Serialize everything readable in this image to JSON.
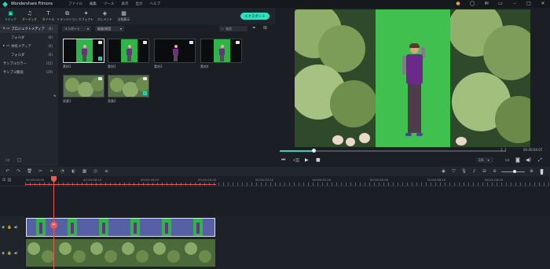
{
  "app": {
    "title": "Wondershare Filmora"
  },
  "menu": [
    "ファイル",
    "編集",
    "ツール",
    "表示",
    "出力",
    "ヘルプ"
  ],
  "toolbar": {
    "tabs": [
      {
        "label": "メディア",
        "icon": "media-icon"
      },
      {
        "label": "オーディオ",
        "icon": "music-icon"
      },
      {
        "label": "タイトル",
        "icon": "title-icon"
      },
      {
        "label": "トランジション",
        "icon": "transition-icon"
      },
      {
        "label": "エフェクト",
        "icon": "effect-icon"
      },
      {
        "label": "エレメント",
        "icon": "element-icon"
      },
      {
        "label": "分割表示",
        "icon": "split-icon"
      }
    ],
    "export_label": "エクスポート",
    "active_color": "#2ee6c3"
  },
  "left_panel": {
    "items": [
      {
        "label": "プロジェクトメディア",
        "count": "(6)"
      },
      {
        "label": "フォルダ",
        "count": "(6)"
      },
      {
        "label": "共有メディア",
        "count": "(0)"
      },
      {
        "label": "フォルダ",
        "count": "(0)"
      },
      {
        "label": "サンプルカラー",
        "count": "(15)"
      },
      {
        "label": "サンプル動画",
        "count": "(20)"
      }
    ]
  },
  "media": {
    "import_label": "インポート",
    "record_label": "録画/録音",
    "search_placeholder": "検索",
    "clips": [
      {
        "label": "素材1"
      },
      {
        "label": "素材1"
      },
      {
        "label": "素材3"
      },
      {
        "label": "素材4"
      },
      {
        "label": "背景1"
      },
      {
        "label": "背景2"
      }
    ]
  },
  "preview": {
    "timecode": "00:00:04:07",
    "quality": "2/6",
    "progress": 0.15
  },
  "timeline": {
    "ticks": [
      "00:00:00:00",
      "00:00:08:10",
      "00:00:16:20",
      "00:00:25:00",
      "00:00:33:10",
      "00:00:41:20",
      "00:00:50:00",
      "00:00:58:10",
      "00:01:06:20"
    ],
    "zoom": 0.55
  }
}
